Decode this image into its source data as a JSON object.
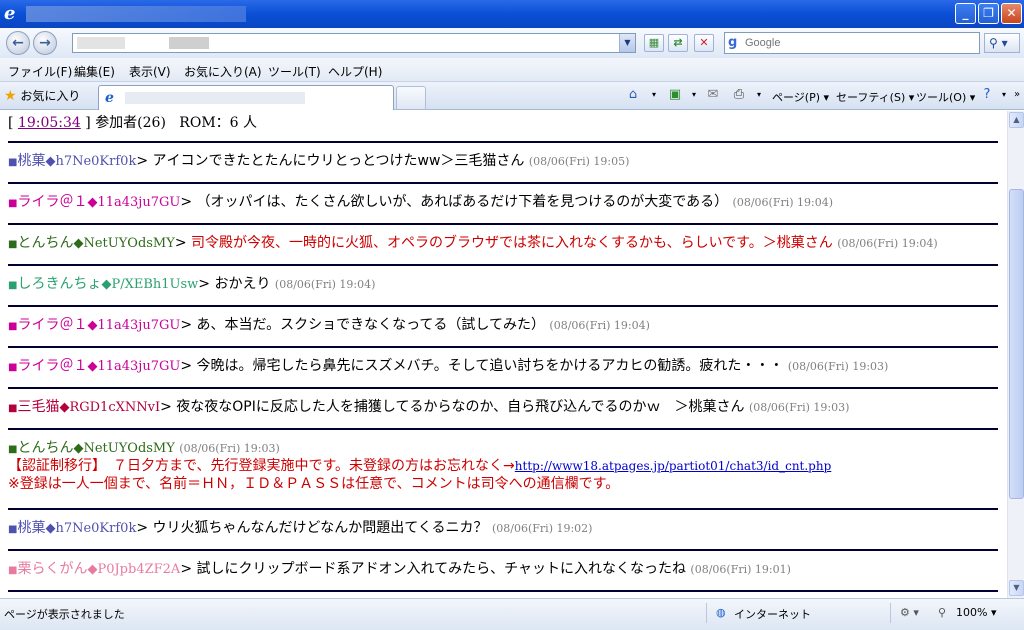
{
  "window": {
    "minimize_glyph": "_",
    "maximize_glyph": "❐",
    "close_glyph": "✕"
  },
  "toolbar": {
    "back_glyph": "←",
    "forward_glyph": "→",
    "search_placeholder": "Google"
  },
  "menu": {
    "items": [
      "ファイル(F)",
      "編集(E)",
      "表示(V)",
      "お気に入り(A)",
      "ツール(T)",
      "ヘルプ(H)"
    ]
  },
  "favorites": {
    "label": "お気に入り"
  },
  "command_bar": {
    "page": "ページ(P)",
    "safety": "セーフティ(S)",
    "tools": "ツール(O)"
  },
  "chat": {
    "time": "19:05:34",
    "participants": "参加者(26)",
    "rom": "ROM：6 人",
    "posts": [
      {
        "name": "桃菓",
        "trip": "◆h7Ne0Krf0k",
        "message": "アイコンできたとたんにウリとっとつけたww＞三毛猫さん",
        "time": "(08/06(Fri) 19:05)",
        "color": "#5050b0",
        "msg_color": "#000000"
      },
      {
        "name": "ライラ＠１",
        "trip": "◆11a43ju7GU",
        "message": "（オッパイは、たくさん欲しいが、あればあるだけ下着を見つけるのが大変である）",
        "time": "(08/06(Fri) 19:04)",
        "color": "#cc0099",
        "msg_color": "#000000"
      },
      {
        "name": "とんちん",
        "trip": "◆NetUYOdsMY",
        "message": "司令殿が今夜、一時的に火狐、オペラのブラウザでは茶に入れなくするかも、らしいです。＞桃菓さん",
        "time": "(08/06(Fri) 19:04)",
        "color": "#2e6b1a",
        "msg_color": "#cc0000"
      },
      {
        "name": "しろきんちょ",
        "trip": "◆P/XEBh1Usw",
        "message": "おかえり",
        "time": "(08/06(Fri) 19:04)",
        "color": "#2aa070",
        "msg_color": "#000000"
      },
      {
        "name": "ライラ＠１",
        "trip": "◆11a43ju7GU",
        "message": "あ、本当だ。スクショできなくなってる（試してみた）",
        "time": "(08/06(Fri) 19:04)",
        "color": "#cc0099",
        "msg_color": "#000000"
      },
      {
        "name": "ライラ＠１",
        "trip": "◆11a43ju7GU",
        "message": "今晩は。帰宅したら鼻先にスズメバチ。そして追い討ちをかけるアカヒの勧誘。疲れた・・・",
        "time": "(08/06(Fri) 19:03)",
        "color": "#cc0099",
        "msg_color": "#000000"
      },
      {
        "name": "三毛猫",
        "trip": "◆RGD1cXNNvI",
        "message": "夜な夜なOPIに反応した人を捕獲してるからなのか、自ら飛び込んでるのかｗ　＞桃菓さん",
        "time": "(08/06(Fri) 19:03)",
        "color": "#b3003c",
        "msg_color": "#000000"
      },
      {
        "name": "とんちん",
        "trip": "◆NetUYOdsMY",
        "message": "",
        "time": "(08/06(Fri) 19:03)",
        "color": "#2e6b1a",
        "msg_color": "#000000"
      },
      {
        "name": "桃菓",
        "trip": "◆h7Ne0Krf0k",
        "message": "ウリ火狐ちゃんなんだけどなんか問題出てくるニカ？",
        "time": "(08/06(Fri) 19:02)",
        "color": "#5050b0",
        "msg_color": "#000000"
      },
      {
        "name": "栗らくがん",
        "trip": "◆P0Jpb4ZF2A",
        "message": "試しにクリップボード系アドオン入れてみたら、チャットに入れなくなったね",
        "time": "(08/06(Fri) 19:01)",
        "color": "#e87aa0",
        "msg_color": "#000000"
      }
    ],
    "notice": {
      "line1": "【認証制移行】　７日夕方まで、先行登録実施中です。未登録の方はお忘れなく→",
      "link": "http://www18.atpages.jp/partiot01/chat3/id_cnt.php",
      "line2": "※登録は一人一個まで、名前＝ＨＮ，ＩＤ＆ＰＡＳＳは任意で、コメントは司令への通信欄です。"
    }
  },
  "status": {
    "text": "ページが表示されました",
    "zone": "インターネット",
    "zoom": "100%"
  }
}
